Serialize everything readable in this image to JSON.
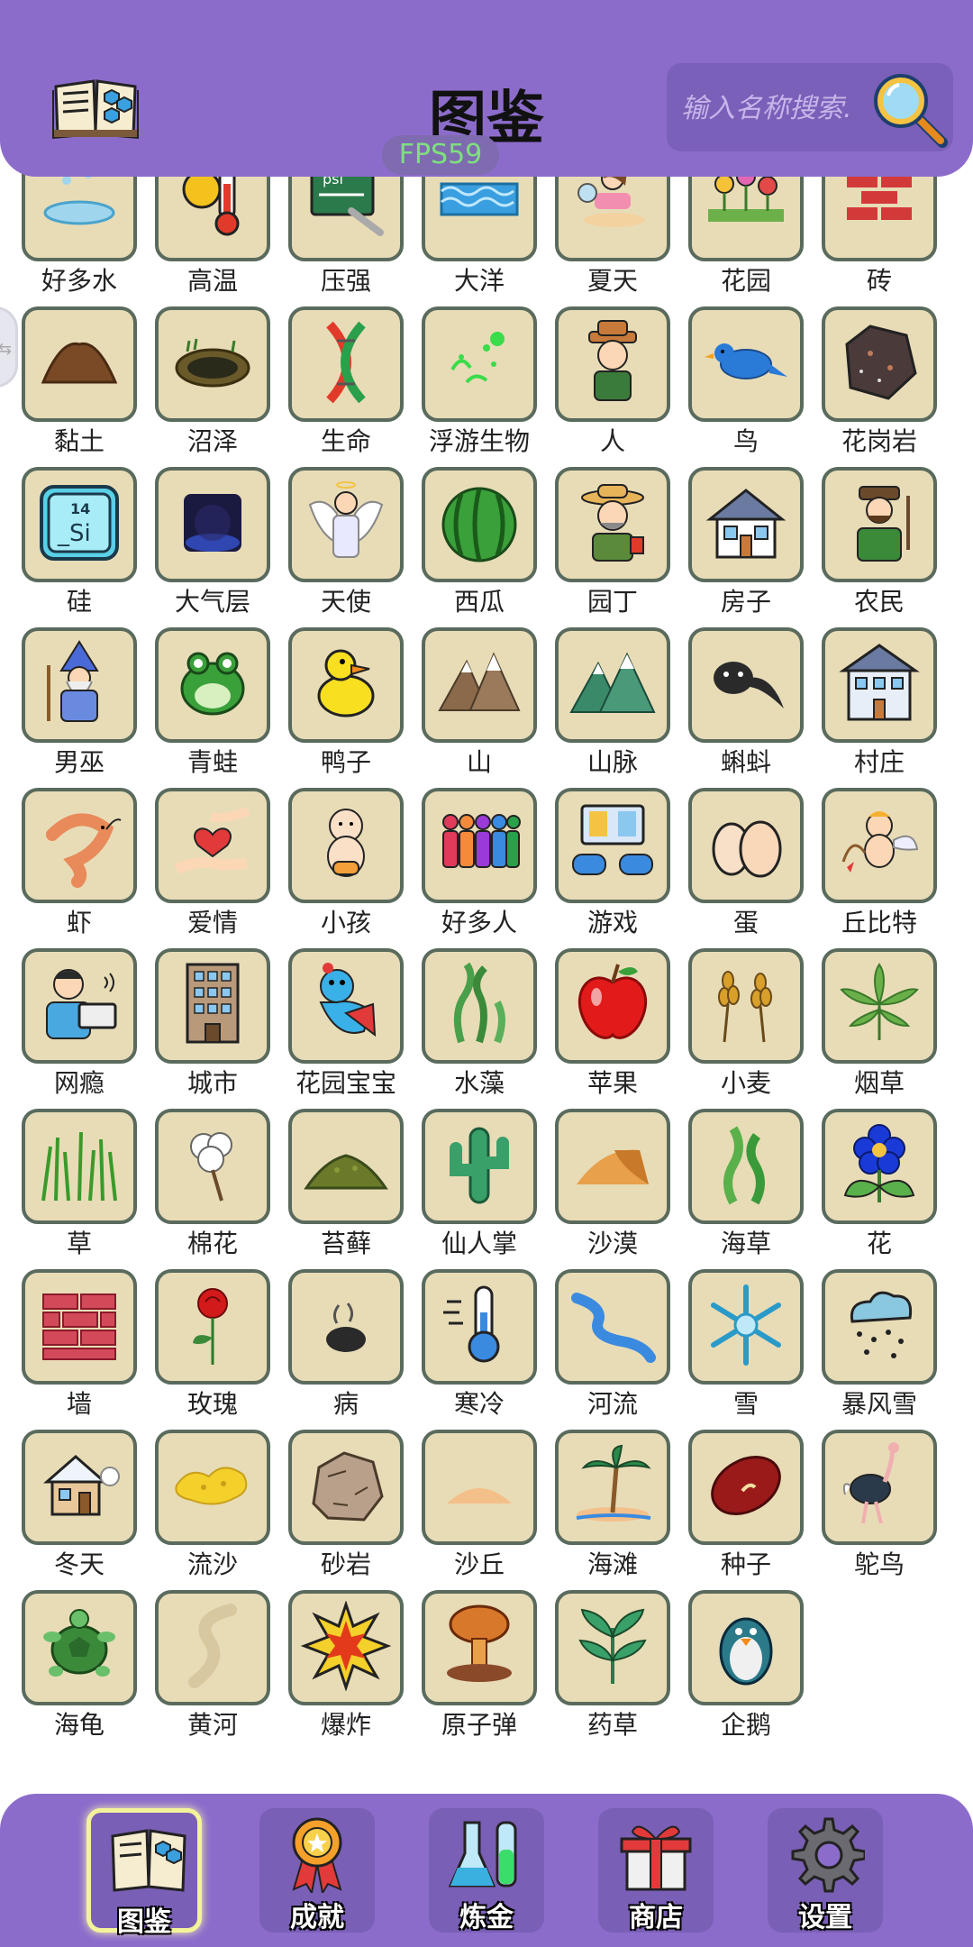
{
  "header": {
    "title": "图鉴",
    "search_placeholder": "输入名称搜索.",
    "fps": "FPS59",
    "icons": {
      "logo": "open-book-icon",
      "search": "magnifier-icon"
    }
  },
  "side_tab": {
    "label": "⇆",
    "icon": "side-drawer-icon"
  },
  "items": [
    {
      "label": "好多水",
      "icon": "puddle-icon"
    },
    {
      "label": "高温",
      "icon": "thermometer-sun-icon"
    },
    {
      "label": "压强",
      "icon": "pressure-board-icon"
    },
    {
      "label": "大洋",
      "icon": "ocean-icon"
    },
    {
      "label": "夏天",
      "icon": "summer-icon"
    },
    {
      "label": "花园",
      "icon": "garden-icon"
    },
    {
      "label": "砖",
      "icon": "brick-icon"
    },
    {
      "label": "黏土",
      "icon": "clay-icon"
    },
    {
      "label": "沼泽",
      "icon": "swamp-icon"
    },
    {
      "label": "生命",
      "icon": "dna-icon"
    },
    {
      "label": "浮游生物",
      "icon": "plankton-icon"
    },
    {
      "label": "人",
      "icon": "person-icon"
    },
    {
      "label": "鸟",
      "icon": "bird-icon"
    },
    {
      "label": "花岗岩",
      "icon": "granite-icon"
    },
    {
      "label": "硅",
      "icon": "silicon-icon"
    },
    {
      "label": "大气层",
      "icon": "atmosphere-icon"
    },
    {
      "label": "天使",
      "icon": "angel-icon"
    },
    {
      "label": "西瓜",
      "icon": "watermelon-icon"
    },
    {
      "label": "园丁",
      "icon": "gardener-icon"
    },
    {
      "label": "房子",
      "icon": "house-icon"
    },
    {
      "label": "农民",
      "icon": "farmer-icon"
    },
    {
      "label": "男巫",
      "icon": "wizard-icon"
    },
    {
      "label": "青蛙",
      "icon": "frog-icon"
    },
    {
      "label": "鸭子",
      "icon": "duck-icon"
    },
    {
      "label": "山",
      "icon": "mountain-icon"
    },
    {
      "label": "山脉",
      "icon": "mountain-range-icon"
    },
    {
      "label": "蝌蚪",
      "icon": "tadpole-icon"
    },
    {
      "label": "村庄",
      "icon": "village-icon"
    },
    {
      "label": "虾",
      "icon": "shrimp-icon"
    },
    {
      "label": "爱情",
      "icon": "heart-hands-icon"
    },
    {
      "label": "小孩",
      "icon": "baby-icon"
    },
    {
      "label": "好多人",
      "icon": "crowd-icon"
    },
    {
      "label": "游戏",
      "icon": "game-icon"
    },
    {
      "label": "蛋",
      "icon": "eggs-icon"
    },
    {
      "label": "丘比特",
      "icon": "cupid-icon"
    },
    {
      "label": "网瘾",
      "icon": "laptop-user-icon"
    },
    {
      "label": "城市",
      "icon": "building-icon"
    },
    {
      "label": "花园宝宝",
      "icon": "garden-baby-icon"
    },
    {
      "label": "水藻",
      "icon": "algae-icon"
    },
    {
      "label": "苹果",
      "icon": "apple-icon"
    },
    {
      "label": "小麦",
      "icon": "wheat-icon"
    },
    {
      "label": "烟草",
      "icon": "tobacco-leaf-icon"
    },
    {
      "label": "草",
      "icon": "grass-icon"
    },
    {
      "label": "棉花",
      "icon": "cotton-icon"
    },
    {
      "label": "苔藓",
      "icon": "moss-icon"
    },
    {
      "label": "仙人掌",
      "icon": "cactus-icon"
    },
    {
      "label": "沙漠",
      "icon": "desert-icon"
    },
    {
      "label": "海草",
      "icon": "seaweed-icon"
    },
    {
      "label": "花",
      "icon": "flower-icon"
    },
    {
      "label": "墙",
      "icon": "wall-icon"
    },
    {
      "label": "玫瑰",
      "icon": "rose-icon"
    },
    {
      "label": "病",
      "icon": "sickness-icon"
    },
    {
      "label": "寒冷",
      "icon": "cold-thermometer-icon"
    },
    {
      "label": "河流",
      "icon": "river-icon"
    },
    {
      "label": "雪",
      "icon": "snowflake-icon"
    },
    {
      "label": "暴风雪",
      "icon": "blizzard-icon"
    },
    {
      "label": "冬天",
      "icon": "winter-house-icon"
    },
    {
      "label": "流沙",
      "icon": "quicksand-icon"
    },
    {
      "label": "砂岩",
      "icon": "sandstone-icon"
    },
    {
      "label": "沙丘",
      "icon": "dune-icon"
    },
    {
      "label": "海滩",
      "icon": "beach-icon"
    },
    {
      "label": "种子",
      "icon": "seed-icon"
    },
    {
      "label": "鸵鸟",
      "icon": "ostrich-icon"
    },
    {
      "label": "海龟",
      "icon": "turtle-icon"
    },
    {
      "label": "黄河",
      "icon": "yellow-river-icon"
    },
    {
      "label": "爆炸",
      "icon": "explosion-icon"
    },
    {
      "label": "原子弹",
      "icon": "mushroom-cloud-icon"
    },
    {
      "label": "药草",
      "icon": "herb-icon"
    },
    {
      "label": "企鹅",
      "icon": "penguin-icon"
    }
  ],
  "nav": [
    {
      "label": "图鉴",
      "icon": "book-icon",
      "active": true
    },
    {
      "label": "成就",
      "icon": "medal-icon",
      "active": false
    },
    {
      "label": "炼金",
      "icon": "flask-icon",
      "active": false
    },
    {
      "label": "商店",
      "icon": "gift-icon",
      "active": false
    },
    {
      "label": "设置",
      "icon": "gear-icon",
      "active": false
    }
  ],
  "colors": {
    "header_bg": "#8c6ccb",
    "tile_bg": "#e8dcb7",
    "tile_border": "#5a6b5d",
    "fps_text": "#7ee07e",
    "nav_active_border": "#f3f39a"
  }
}
